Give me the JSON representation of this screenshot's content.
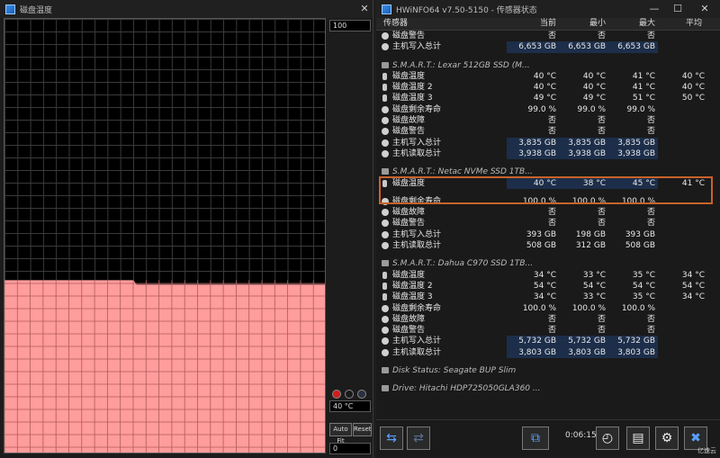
{
  "graph_window": {
    "title": "磁盘温度",
    "scale_top": "100",
    "current_value": "40 °C",
    "scale_bottom": "0",
    "auto_fit_label": "Auto Fit",
    "reset_label": "Reset",
    "line_color": "#ff9c9c",
    "level_percent_start": 40,
    "level_percent_end": 39
  },
  "sensor_window": {
    "title": "HWiNFO64 v7.50-5150 - 传感器状态",
    "columns": [
      "传感器",
      "当前",
      "最小",
      "最大",
      "平均"
    ],
    "rows": [
      {
        "kind": "data",
        "icon": "circle-icon",
        "name": "磁盘警告",
        "cur": "否",
        "min": "否",
        "max": "否",
        "avg": ""
      },
      {
        "kind": "data",
        "icon": "circle-icon",
        "name": "主机写入总计",
        "cur": "6,653 GB",
        "min": "6,653 GB",
        "max": "6,653 GB",
        "avg": "",
        "hl": true
      },
      {
        "kind": "empty"
      },
      {
        "kind": "section",
        "name": "S.M.A.R.T.: Lexar 512GB SSD (M..."
      },
      {
        "kind": "data",
        "icon": "thermometer-icon",
        "name": "磁盘温度",
        "cur": "40 °C",
        "min": "40 °C",
        "max": "41 °C",
        "avg": "40 °C"
      },
      {
        "kind": "data",
        "icon": "thermometer-icon",
        "name": "磁盘温度 2",
        "cur": "40 °C",
        "min": "40 °C",
        "max": "41 °C",
        "avg": "40 °C"
      },
      {
        "kind": "data",
        "icon": "thermometer-icon",
        "name": "磁盘温度 3",
        "cur": "49 °C",
        "min": "49 °C",
        "max": "51 °C",
        "avg": "50 °C"
      },
      {
        "kind": "data",
        "icon": "circle-icon",
        "name": "磁盘剩余寿命",
        "cur": "99.0 %",
        "min": "99.0 %",
        "max": "99.0 %",
        "avg": ""
      },
      {
        "kind": "data",
        "icon": "circle-icon",
        "name": "磁盘故障",
        "cur": "否",
        "min": "否",
        "max": "否",
        "avg": ""
      },
      {
        "kind": "data",
        "icon": "circle-icon",
        "name": "磁盘警告",
        "cur": "否",
        "min": "否",
        "max": "否",
        "avg": ""
      },
      {
        "kind": "data",
        "icon": "circle-icon",
        "name": "主机写入总计",
        "cur": "3,835 GB",
        "min": "3,835 GB",
        "max": "3,835 GB",
        "avg": "",
        "hl": true
      },
      {
        "kind": "data",
        "icon": "circle-icon",
        "name": "主机读取总计",
        "cur": "3,938 GB",
        "min": "3,938 GB",
        "max": "3,938 GB",
        "avg": "",
        "hl": true
      },
      {
        "kind": "empty"
      },
      {
        "kind": "section",
        "name": "S.M.A.R.T.: Netac NVMe SSD 1TB..."
      },
      {
        "kind": "data",
        "icon": "thermometer-icon",
        "name": "磁盘温度",
        "cur": "40 °C",
        "min": "38 °C",
        "max": "45 °C",
        "avg": "41 °C",
        "hl": true
      },
      {
        "kind": "empty"
      },
      {
        "kind": "data",
        "icon": "circle-icon",
        "name": "磁盘剩余寿命",
        "cur": "100.0 %",
        "min": "100.0 %",
        "max": "100.0 %",
        "avg": ""
      },
      {
        "kind": "data",
        "icon": "circle-icon",
        "name": "磁盘故障",
        "cur": "否",
        "min": "否",
        "max": "否",
        "avg": ""
      },
      {
        "kind": "data",
        "icon": "circle-icon",
        "name": "磁盘警告",
        "cur": "否",
        "min": "否",
        "max": "否",
        "avg": ""
      },
      {
        "kind": "data",
        "icon": "circle-icon",
        "name": "主机写入总计",
        "cur": "393 GB",
        "min": "198 GB",
        "max": "393 GB",
        "avg": ""
      },
      {
        "kind": "data",
        "icon": "circle-icon",
        "name": "主机读取总计",
        "cur": "508 GB",
        "min": "312 GB",
        "max": "508 GB",
        "avg": ""
      },
      {
        "kind": "empty"
      },
      {
        "kind": "section",
        "name": "S.M.A.R.T.: Dahua C970 SSD 1TB..."
      },
      {
        "kind": "data",
        "icon": "thermometer-icon",
        "name": "磁盘温度",
        "cur": "34 °C",
        "min": "33 °C",
        "max": "35 °C",
        "avg": "34 °C"
      },
      {
        "kind": "data",
        "icon": "thermometer-icon",
        "name": "磁盘温度 2",
        "cur": "54 °C",
        "min": "54 °C",
        "max": "54 °C",
        "avg": "54 °C"
      },
      {
        "kind": "data",
        "icon": "thermometer-icon",
        "name": "磁盘温度 3",
        "cur": "34 °C",
        "min": "33 °C",
        "max": "35 °C",
        "avg": "34 °C"
      },
      {
        "kind": "data",
        "icon": "circle-icon",
        "name": "磁盘剩余寿命",
        "cur": "100.0 %",
        "min": "100.0 %",
        "max": "100.0 %",
        "avg": ""
      },
      {
        "kind": "data",
        "icon": "circle-icon",
        "name": "磁盘故障",
        "cur": "否",
        "min": "否",
        "max": "否",
        "avg": ""
      },
      {
        "kind": "data",
        "icon": "circle-icon",
        "name": "磁盘警告",
        "cur": "否",
        "min": "否",
        "max": "否",
        "avg": ""
      },
      {
        "kind": "data",
        "icon": "circle-icon",
        "name": "主机写入总计",
        "cur": "5,732 GB",
        "min": "5,732 GB",
        "max": "5,732 GB",
        "avg": "",
        "hl": true
      },
      {
        "kind": "data",
        "icon": "circle-icon",
        "name": "主机读取总计",
        "cur": "3,803 GB",
        "min": "3,803 GB",
        "max": "3,803 GB",
        "avg": "",
        "hl": true
      },
      {
        "kind": "empty"
      },
      {
        "kind": "section",
        "name": "Disk Status: Seagate BUP Slim"
      },
      {
        "kind": "empty"
      },
      {
        "kind": "section",
        "name": "Drive: Hitachi HDP725050GLA360 ..."
      }
    ],
    "timer": "0:06:15",
    "watermark": "亿速云"
  }
}
